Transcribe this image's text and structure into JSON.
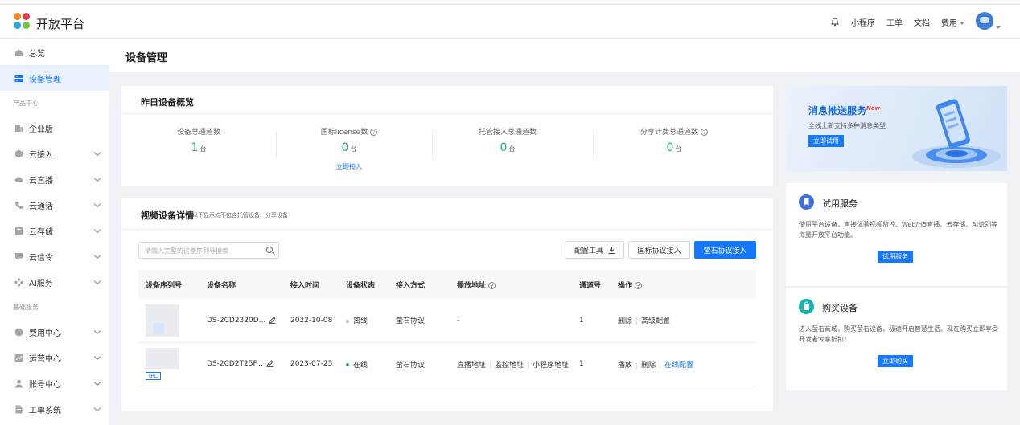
{
  "header": {
    "brand": "开放平台",
    "nav": [
      "小程序",
      "工单",
      "文档",
      "费用"
    ]
  },
  "sidebar": {
    "items": [
      {
        "label": "总览",
        "icon": "home-icon"
      },
      {
        "label": "设备管理",
        "icon": "device-icon",
        "active": true
      }
    ],
    "section_product": "产品中心",
    "product_items": [
      {
        "label": "企业版",
        "icon": "building-icon"
      },
      {
        "label": "云接入",
        "icon": "cube-icon"
      },
      {
        "label": "云直播",
        "icon": "cloud-icon"
      },
      {
        "label": "云通话",
        "icon": "phone-icon"
      },
      {
        "label": "云存储",
        "icon": "storage-icon"
      },
      {
        "label": "云信令",
        "icon": "message-icon"
      },
      {
        "label": "AI服务",
        "icon": "ai-icon"
      }
    ],
    "section_base": "基础服务",
    "base_items": [
      {
        "label": "费用中心",
        "icon": "coin-icon"
      },
      {
        "label": "运营中心",
        "icon": "chart-icon"
      },
      {
        "label": "账号中心",
        "icon": "user-icon"
      },
      {
        "label": "工单系统",
        "icon": "ticket-icon"
      }
    ]
  },
  "page": {
    "title": "设备管理"
  },
  "overview": {
    "title": "昨日设备概览",
    "stats": [
      {
        "label": "设备总通道数",
        "value": "1",
        "unit": "台"
      },
      {
        "label": "国标license数",
        "value": "0",
        "unit": "台"
      },
      {
        "label": "托管接入总通道数",
        "value": "0",
        "unit": "台"
      },
      {
        "label": "分享计费总通道数",
        "value": "0",
        "unit": "台"
      }
    ],
    "link": "立即接入"
  },
  "video": {
    "title": "视频设备详情",
    "subtitle": "以下显示均不包含托管设备、分享设备",
    "search_placeholder": "请输入完整的设备序列号搜索",
    "buttons": {
      "config_tool": "配置工具",
      "gb_access": "国标协议接入",
      "ys_access": "萤石协议接入"
    },
    "columns": [
      "设备序列号",
      "设备名称",
      "接入时间",
      "设备状态",
      "接入方式",
      "播放地址",
      "通道号",
      "操作"
    ],
    "rows": [
      {
        "name": "DS-2CD2320D...",
        "time": "2022-10-08",
        "status": "离线",
        "status_color": "#bbbbbb",
        "method": "萤石协议",
        "address": "-",
        "channel": "1",
        "ops": [
          "删除",
          "高级配置"
        ]
      },
      {
        "name": "DS-2CD2T25F...",
        "tag": "IPC",
        "time": "2023-07-25",
        "status": "在线",
        "status_color": "#1fad5a",
        "method": "萤石协议",
        "address": [
          "直播地址",
          "监控地址",
          "小程序地址"
        ],
        "channel": "1",
        "ops": [
          "播放",
          "删除",
          "在线配置"
        ]
      }
    ]
  },
  "banner": {
    "title": "消息推送服务",
    "badge": "New",
    "desc": "全线上新支持多种消息类型",
    "button": "立即试用"
  },
  "trial": {
    "title": "试用服务",
    "desc": "使用平台设备，直接体验视频监控、Web/H5直播、云存储、AI识别等海量开放平台功能。",
    "button": "试用服务",
    "color": "#3f6fe0"
  },
  "buy": {
    "title": "购买设备",
    "desc": "进入萤石商城，购买萤石设备，极速开启智慧生活。现在购买立即享受开发者专享折扣！",
    "button": "立即购买",
    "color": "#13b5b1"
  },
  "colors": {
    "accent": "#1677ff",
    "online": "#1fad5a",
    "offline": "#bbbbbb"
  }
}
